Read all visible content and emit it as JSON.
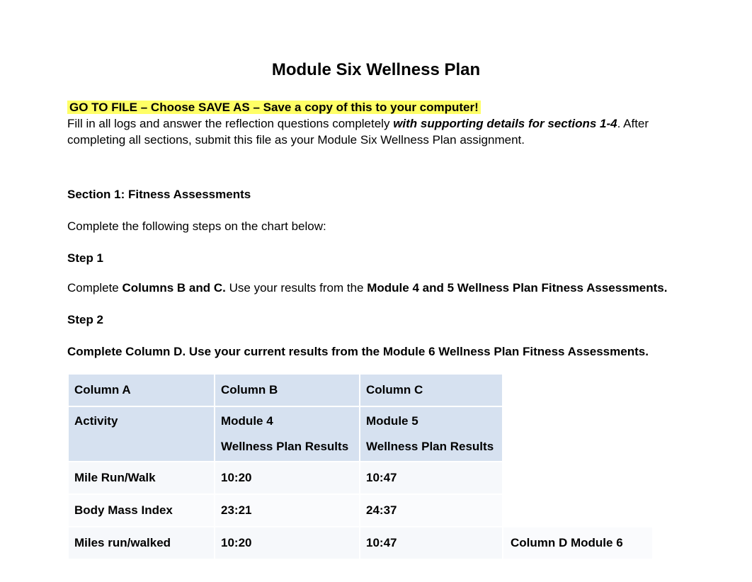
{
  "title": "Module Six Wellness Plan",
  "highlight": "GO TO FILE – Choose SAVE AS – Save a copy of this to your computer!",
  "intro_pre": "Fill in all logs and answer the reflection questions completely ",
  "intro_emph": "with supporting details for sections 1-4",
  "intro_post": ". After completing all sections, submit this file as your Module Six Wellness Plan assignment.",
  "section1_title": "Section 1: Fitness Assessments",
  "section1_intro": "Complete the following steps on the chart below:",
  "step1_title": "Step 1",
  "step1_pre": "Complete",
  "step1_bold1": " Columns B and C.",
  "step1_mid": " Use your results from the ",
  "step1_bold2": "Module 4 and 5 Wellness Plan Fitness Assessments.",
  "step2_title": "Step 2",
  "step2_body": "Complete Column D. Use your current results from the Module 6 Wellness Plan Fitness Assessments.",
  "table": {
    "header1": {
      "a": "Column A",
      "b": "Column B",
      "c": "Column C"
    },
    "header2": {
      "a": "Activity",
      "b1": "Module 4",
      "b2": "Wellness Plan Results",
      "c1": "Module 5",
      "c2": "Wellness Plan Results"
    },
    "rows": [
      {
        "a": "Mile Run/Walk",
        "b": "10:20",
        "c": "10:47"
      },
      {
        "a": "Body Mass Index",
        "b": "23:21",
        "c": "24:37"
      },
      {
        "a": "Miles run/walked",
        "b": "10:20",
        "c": "10:47",
        "d": "Column D Module 6"
      }
    ]
  }
}
